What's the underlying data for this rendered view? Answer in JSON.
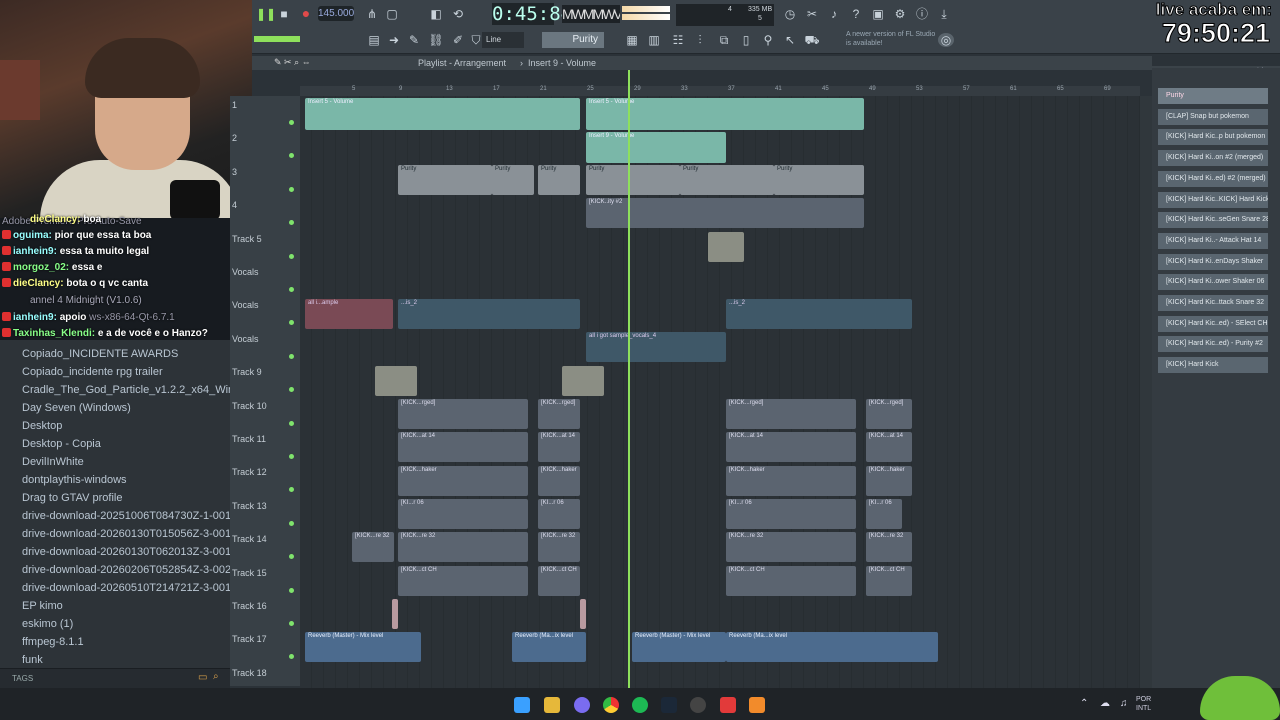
{
  "overlay": {
    "live_title": "live acaba em:",
    "live_time": "79:50:21"
  },
  "toolbar": {
    "tempo": "145.000",
    "timecode": "0:45:84",
    "cpu_top": "4",
    "ram": "335 MB",
    "cpu_bottom": "5",
    "line_mode": "Line",
    "pattern": "Purity",
    "news": "A newer version of FL Studio is available!"
  },
  "playlist": {
    "title": "Playlist - Arrangement",
    "crumb": "Insert 9 - Volume",
    "ruler": [
      "5",
      "9",
      "13",
      "17",
      "21",
      "25",
      "29",
      "33",
      "37",
      "41",
      "45",
      "49",
      "53",
      "57",
      "61",
      "65",
      "69"
    ],
    "tracks": [
      {
        "label": "1"
      },
      {
        "label": "2"
      },
      {
        "label": "3"
      },
      {
        "label": "4"
      },
      {
        "label": "Track 5"
      },
      {
        "label": "Vocals"
      },
      {
        "label": "Vocals"
      },
      {
        "label": "Vocals"
      },
      {
        "label": "Track 9"
      },
      {
        "label": "Track 10"
      },
      {
        "label": "Track 11"
      },
      {
        "label": "Track 12"
      },
      {
        "label": "Track 13"
      },
      {
        "label": "Track 14"
      },
      {
        "label": "Track 15"
      },
      {
        "label": "Track 16"
      },
      {
        "label": "Track 17"
      },
      {
        "label": "Track 18"
      }
    ],
    "clips": {
      "insert5": "Insert 5 - Volume",
      "insert9": "Insert 9 - Volume",
      "purity": "Purity",
      "kick_ity": "[KICK..ity #2",
      "vocal_sample": "all i...ample",
      "vocal_ple": "all...ple",
      "vocal_is2": "...is_2",
      "got_sample": "all i got sample_vocals_4",
      "all_ocals": "all...ocals_4",
      "kick_rged": "[KICK...rged]",
      "kick_at14": "[KICK...at 14",
      "kick_haker": "[KICK...haker",
      "kick_r06": "[KI...r 06",
      "kick_re32": "[KICK...re 32",
      "kick_ctch": "[KICK...ct CH",
      "reverb": "Reeverb (Master) - Mix level",
      "reverb_short": "Reeverb (Ma...ix level"
    }
  },
  "picker": {
    "items": [
      "Purity",
      "[CLAP] Snap but pokemon",
      "[KICK] Hard Kic..p but pokemon",
      "[KICK] Hard Ki..on #2 (merged)",
      "[KICK] Hard Ki..ed) #2 (merged)",
      "[KICK] Hard Kic..KICK] Hard Kick",
      "[KICK] Hard Kic..seGen Snare 28",
      "[KICK] Hard Ki..- Attack Hat 14",
      "[KICK] Hard Ki..enDays Shaker",
      "[KICK] Hard Ki..ower Shaker 06",
      "[KICK] Hard Kic..ttack Snare 32",
      "[KICK] Hard Kic..ed) - SElect CH",
      "[KICK] Hard Kic..ed) - Purity #2",
      "[KICK] Hard Kick"
    ]
  },
  "chat": {
    "lines": [
      {
        "user": "dieClancy:",
        "msg": "boa"
      },
      {
        "user": "oguima:",
        "msg": "pior que essa ta boa"
      },
      {
        "user": "ianhein9:",
        "msg": "essa ta muito legal"
      },
      {
        "user": "morgoz_02:",
        "msg": "essa e"
      },
      {
        "user": "dieClancy:",
        "msg": "bota o q vc canta"
      },
      {
        "user": "ianhein9:",
        "msg": "apoio"
      },
      {
        "user": "Taxinhas_Klendi:",
        "msg": "e a de você e o Hanzo?"
      }
    ],
    "bg_text": [
      "Adobe Premiere Pro Auto-Save",
      "annel 4 Midnight (V1.0.6)",
      "ws-x86-64-Qt-6.7.1"
    ]
  },
  "explorer": {
    "items": [
      "Copiado_INCIDENTE AWARDS",
      "Copiado_incidente rpg trailer",
      "Cradle_The_God_Particle_v1.2.2_x64_Win_1",
      "Day Seven (Windows)",
      "Desktop",
      "Desktop - Copia",
      "DevilInWhite",
      "dontplaythis-windows",
      "Drag to GTAV profile",
      "drive-download-20251006T084730Z-1-001",
      "drive-download-20260130T015056Z-3-001",
      "drive-download-20260130T062013Z-3-001",
      "drive-download-20260206T052854Z-3-002",
      "drive-download-20260510T214721Z-3-001",
      "EP kimo",
      "eskimo (1)",
      "ffmpeg-8.1.1",
      "funk"
    ],
    "tags_label": "TAGS"
  },
  "taskbar": {
    "lang": "POR",
    "layout": "INTL"
  }
}
